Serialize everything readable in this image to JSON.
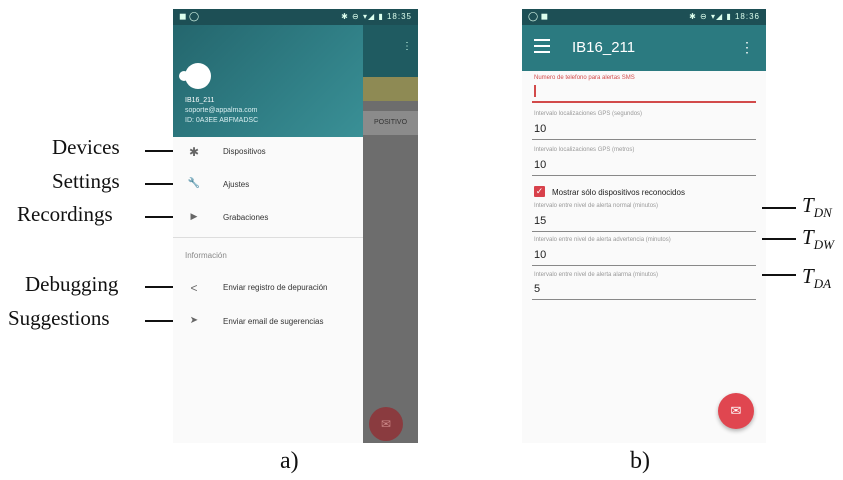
{
  "annotations_left": [
    {
      "text": "Devices"
    },
    {
      "text": "Settings"
    },
    {
      "text": "Recordings"
    },
    {
      "text": "Debugging"
    },
    {
      "text": "Suggestions"
    }
  ],
  "annotations_right": [
    {
      "symbol": "T",
      "sub": "DN"
    },
    {
      "symbol": "T",
      "sub": "DW"
    },
    {
      "symbol": "T",
      "sub": "DA"
    }
  ],
  "captions": {
    "a": "a)",
    "b": "b)"
  },
  "phone_a": {
    "status_left": "◼ ◯",
    "status_right": "✱ ⊖ ▾◢ ▮ 18:35",
    "drawer": {
      "name": "IB16_211",
      "email": "soporte@appalma.com",
      "id": "ID: 0A3EE ABFMADSC",
      "items": [
        {
          "label": "Dispositivos",
          "icon": "bluetooth-icon",
          "glyph": "✱"
        },
        {
          "label": "Ajustes",
          "icon": "wrench-icon",
          "glyph": "🔧"
        },
        {
          "label": "Grabaciones",
          "icon": "play-icon",
          "glyph": "▶"
        }
      ],
      "section_title": "Información",
      "section_items": [
        {
          "label": "Enviar registro de depuración",
          "icon": "share-icon",
          "glyph": "<"
        },
        {
          "label": "Enviar email de sugerencias",
          "icon": "send-icon",
          "glyph": "➤"
        }
      ]
    },
    "behind_tab": "POSITIVO",
    "behind_menu": "⋮",
    "fab_glyph": "✉"
  },
  "phone_b": {
    "status_left": "◯ ◼",
    "status_right": "✱ ⊖ ▾◢ ▮ 18:36",
    "title": "IB16_211",
    "menu_glyph": "⋮",
    "fields": [
      {
        "label": "Numero de telefono para alertas SMS",
        "value": ""
      },
      {
        "label": "Intervalo localizaciones GPS (segundos)",
        "value": "10"
      },
      {
        "label": "Intervalo localizaciones GPS (metros)",
        "value": "10"
      },
      {
        "label": "Intervalo entre nivel de alerta normal (minutos)",
        "value": "15"
      },
      {
        "label": "Intervalo entre nivel de alerta advertencia (minutos)",
        "value": "10"
      },
      {
        "label": "Intervalo entre nivel de alerta alarma (minutos)",
        "value": "5"
      }
    ],
    "checkbox": {
      "label": "Mostrar sólo dispositivos reconocidos",
      "checked": true,
      "glyph": "✓"
    },
    "fab_glyph": "✉"
  },
  "colors": {
    "teal": "#2b7a80",
    "accent": "#e04650",
    "error": "#d24a4a"
  }
}
